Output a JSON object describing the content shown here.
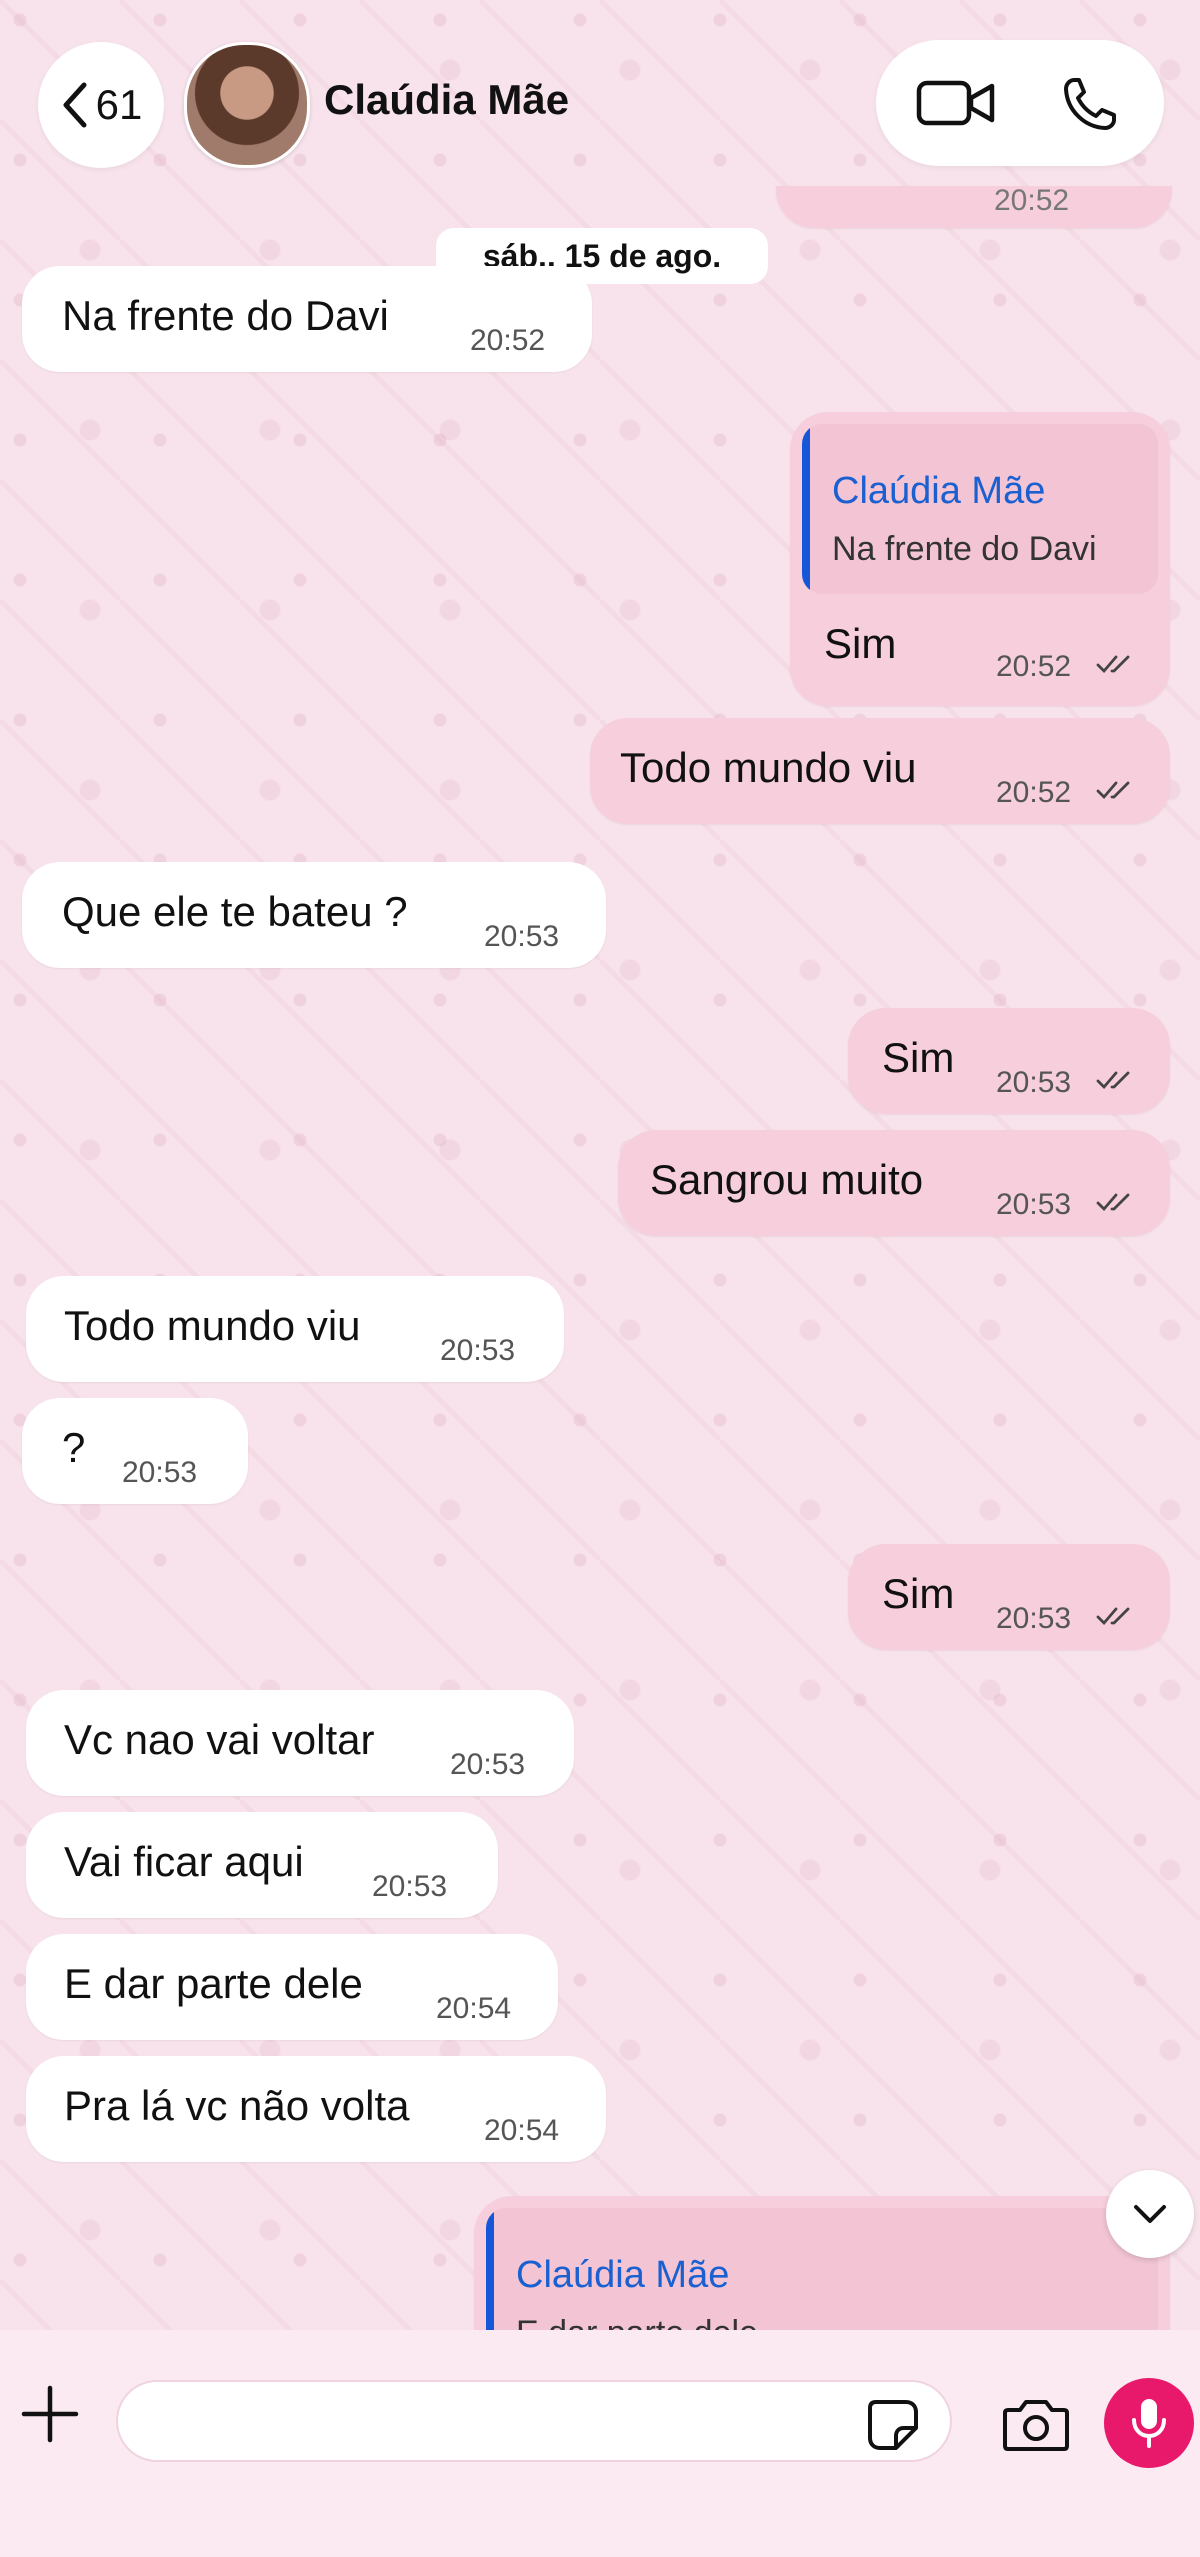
{
  "header": {
    "back_count": "61",
    "contact_name": "Claúdia Mãe"
  },
  "date_separator": "sáb., 15 de ago.",
  "partial_top_time": "20:52",
  "messages": [
    {
      "dir": "in",
      "text": "Na frente do Davi",
      "time": "20:52"
    },
    {
      "dir": "out",
      "text": "Sim",
      "time": "20:52",
      "reply_to": {
        "name": "Claúdia Mãe",
        "text": "Na frente do Davi"
      }
    },
    {
      "dir": "out",
      "text": "Todo mundo viu",
      "time": "20:52"
    },
    {
      "dir": "in",
      "text": "Que ele te bateu ?",
      "time": "20:53"
    },
    {
      "dir": "out",
      "text": "Sim",
      "time": "20:53"
    },
    {
      "dir": "out",
      "text": "Sangrou muito",
      "time": "20:53"
    },
    {
      "dir": "in",
      "text": "Todo mundo viu",
      "time": "20:53"
    },
    {
      "dir": "in",
      "text": "?",
      "time": "20:53"
    },
    {
      "dir": "out",
      "text": "Sim",
      "time": "20:53"
    },
    {
      "dir": "in",
      "text": "Vc nao vai voltar",
      "time": "20:53"
    },
    {
      "dir": "in",
      "text": "Vai ficar aqui",
      "time": "20:53"
    },
    {
      "dir": "in",
      "text": "E dar parte dele",
      "time": "20:54"
    },
    {
      "dir": "in",
      "text": "Pra lá vc não volta",
      "time": "20:54"
    }
  ],
  "partial_reply": {
    "name": "Claúdia Mãe",
    "text": "E dar parte dele"
  },
  "composer": {
    "placeholder": ""
  },
  "colors": {
    "incoming": "#ffffff",
    "outgoing": "#f7cfdc",
    "accent_blue": "#1a60d1",
    "mic": "#e8196b",
    "background": "#f8e3ec"
  },
  "icons": [
    "chevron-left-icon",
    "video-call-icon",
    "phone-icon",
    "plus-icon",
    "sticker-icon",
    "camera-icon",
    "microphone-icon",
    "chevron-down-icon",
    "double-check-icon"
  ]
}
